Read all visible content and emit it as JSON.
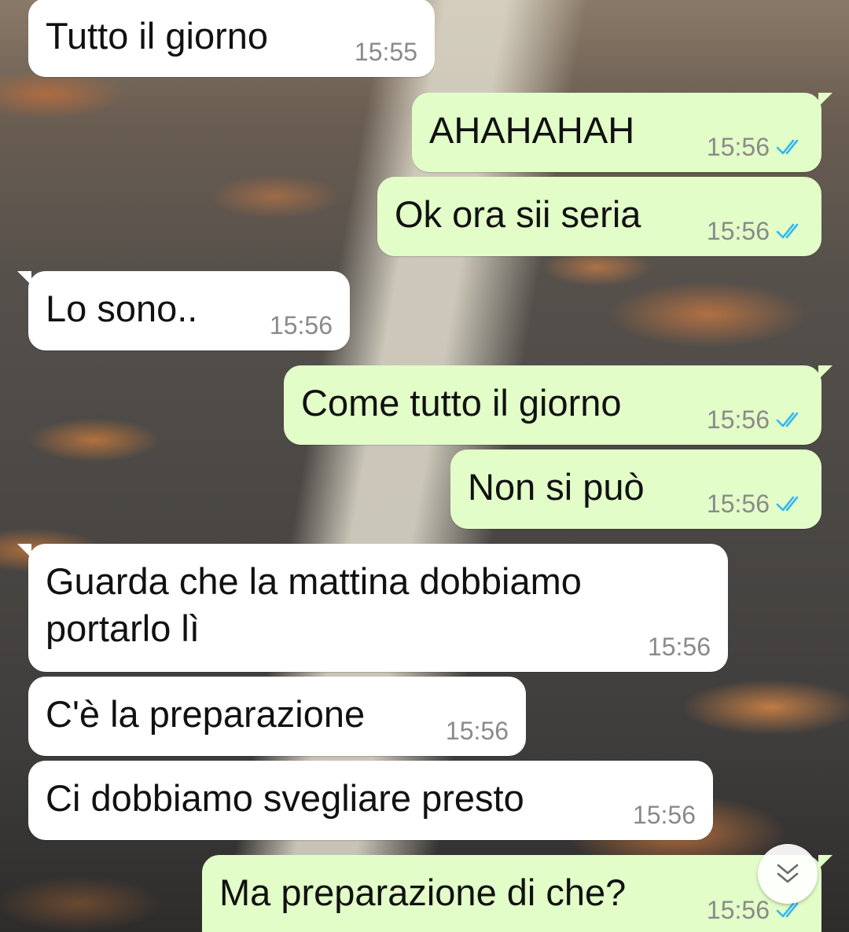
{
  "theme": {
    "incoming_bubble": "#ffffff",
    "outgoing_bubble": "#e2fdc8",
    "read_tick_color": "#34b7f1",
    "timestamp_color": "#8a8a8a"
  },
  "messages": [
    {
      "direction": "in",
      "text": "Tutto il giorno",
      "time": "15:55"
    },
    {
      "direction": "out",
      "text": "AHAHAHAH",
      "time": "15:56",
      "status": "read"
    },
    {
      "direction": "out",
      "text": "Ok ora sii seria",
      "time": "15:56",
      "status": "read"
    },
    {
      "direction": "in",
      "text": "Lo sono..",
      "time": "15:56"
    },
    {
      "direction": "out",
      "text": "Come tutto il giorno",
      "time": "15:56",
      "status": "read"
    },
    {
      "direction": "out",
      "text": "Non si può",
      "time": "15:56",
      "status": "read"
    },
    {
      "direction": "in",
      "text": "Guarda che la mattina dobbiamo\nportarlo lì",
      "time": "15:56"
    },
    {
      "direction": "in",
      "text": "C'è la preparazione",
      "time": "15:56"
    },
    {
      "direction": "in",
      "text": "Ci dobbiamo svegliare presto",
      "time": "15:56"
    },
    {
      "direction": "out",
      "text": "Ma preparazione di che?",
      "time": "15:56",
      "status": "read"
    }
  ],
  "icons": {
    "read_receipt": "double-check-icon",
    "scroll_down": "double-chevron-down-icon"
  }
}
